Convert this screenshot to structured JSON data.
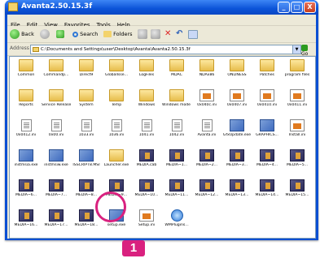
{
  "window": {
    "title": "Avanta2.50.15.3f",
    "minimize_label": "_",
    "maximize_label": "□",
    "close_label": "X"
  },
  "menu": [
    "File",
    "Edit",
    "View",
    "Favorites",
    "Tools",
    "Help"
  ],
  "toolbar": {
    "back_label": "Back",
    "search_label": "Search",
    "folders_label": "Folders"
  },
  "address": {
    "label": "Address",
    "value": "C:\\Documents and Settings\\user\\Desktop\\Avanta\\Avanta2.50.15.3f",
    "go_label": "Go"
  },
  "items": [
    {
      "label": "Common",
      "kind": "folder"
    },
    {
      "label": "Commandp...",
      "kind": "folder"
    },
    {
      "label": "Direct9",
      "kind": "folder"
    },
    {
      "label": "GlobalIsse...",
      "kind": "folder"
    },
    {
      "label": "LogFiles",
      "kind": "folder"
    },
    {
      "label": "MDAC",
      "kind": "folder"
    },
    {
      "label": "NDAx86",
      "kind": "folder"
    },
    {
      "label": "ONLINESS",
      "kind": "folder"
    },
    {
      "label": "Patches",
      "kind": "folder"
    },
    {
      "label": "program files",
      "kind": "folder"
    },
    {
      "label": "Reports",
      "kind": "folder"
    },
    {
      "label": "Service Releases",
      "kind": "folder"
    },
    {
      "label": "System",
      "kind": "folder"
    },
    {
      "label": "Temp",
      "kind": "folder"
    },
    {
      "label": "Windows",
      "kind": "folder"
    },
    {
      "label": "Windows mode esco...",
      "kind": "folder"
    },
    {
      "label": "0x040c.ini",
      "kind": "setupinf"
    },
    {
      "label": "0x0407.ini",
      "kind": "setupinf"
    },
    {
      "label": "0x0410.ini",
      "kind": "setupinf"
    },
    {
      "label": "0x0411.ini",
      "kind": "setupinf"
    },
    {
      "label": "0x0412.ini",
      "kind": "file"
    },
    {
      "label": "0x00.ini",
      "kind": "file"
    },
    {
      "label": "1033.ini",
      "kind": "file"
    },
    {
      "label": "1036.ini",
      "kind": "file"
    },
    {
      "label": "1041.ini",
      "kind": "file"
    },
    {
      "label": "1042.ini",
      "kind": "file"
    },
    {
      "label": "Avanta.ini",
      "kind": "file"
    },
    {
      "label": "GfxUpdate.exe",
      "kind": "exe"
    },
    {
      "label": "GRAPHICS...",
      "kind": "exe"
    },
    {
      "label": "Install.ini",
      "kind": "setupinf"
    },
    {
      "label": "instmsia.exe",
      "kind": "exe"
    },
    {
      "label": "instmsiw.exe",
      "kind": "exe"
    },
    {
      "label": "ISSCRIPT8.MSI",
      "kind": "exe"
    },
    {
      "label": "Launcher.exe",
      "kind": "folder"
    },
    {
      "label": "MEDIA.cab",
      "kind": "installer"
    },
    {
      "label": "MEDIA~1...",
      "kind": "installer"
    },
    {
      "label": "MEDIA~2...",
      "kind": "installer"
    },
    {
      "label": "MEDIA~3...",
      "kind": "installer"
    },
    {
      "label": "MEDIA~4...",
      "kind": "installer"
    },
    {
      "label": "MEDIA~5...",
      "kind": "installer"
    },
    {
      "label": "MEDIA~6...",
      "kind": "installer"
    },
    {
      "label": "MEDIA~7...",
      "kind": "installer"
    },
    {
      "label": "MEDIA~8...",
      "kind": "installer"
    },
    {
      "label": "MEDIA~9...",
      "kind": "installer"
    },
    {
      "label": "MEDIA~10...",
      "kind": "installer"
    },
    {
      "label": "MEDIA~11...",
      "kind": "installer"
    },
    {
      "label": "MEDIA~12...",
      "kind": "installer"
    },
    {
      "label": "MEDIA~13...",
      "kind": "installer"
    },
    {
      "label": "MEDIA~14...",
      "kind": "installer"
    },
    {
      "label": "MEDIA~15...",
      "kind": "installer"
    },
    {
      "label": "MEDIA~16...",
      "kind": "installer"
    },
    {
      "label": "MEDIA~17...",
      "kind": "installer"
    },
    {
      "label": "MEDIA~18...",
      "kind": "installer"
    },
    {
      "label": "setup.exe",
      "kind": "exe"
    },
    {
      "label": "Setup.ini",
      "kind": "setupinf"
    },
    {
      "label": "WMPlugins...",
      "kind": "ie"
    }
  ],
  "callout": {
    "number": "1",
    "color": "#d9217f"
  }
}
